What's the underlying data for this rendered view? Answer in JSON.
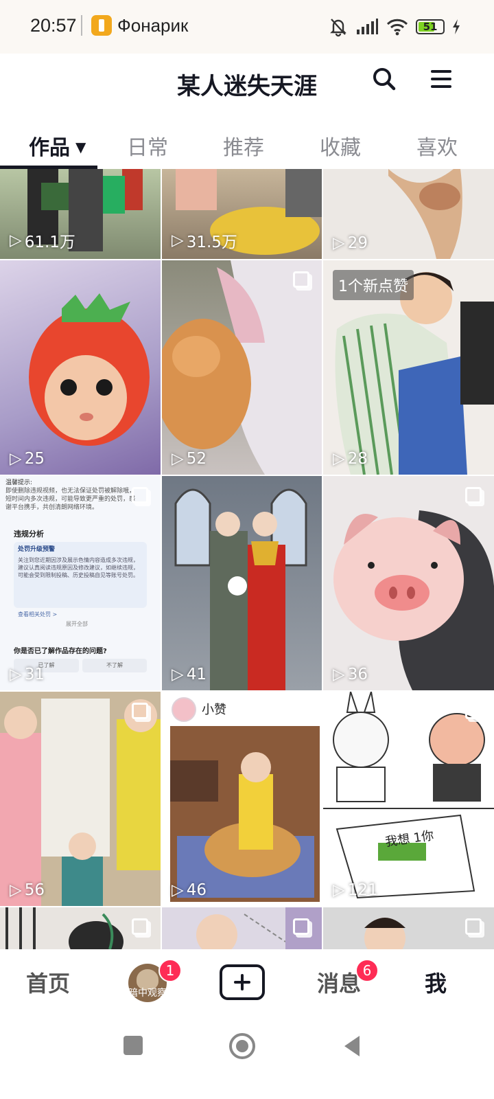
{
  "status_bar": {
    "time": "20:57",
    "app_name": "Фонарик",
    "battery": "51"
  },
  "header": {
    "title": "某人迷失天涯"
  },
  "tabs": [
    {
      "label": "作品",
      "active": true
    },
    {
      "label": "日常"
    },
    {
      "label": "推荐"
    },
    {
      "label": "收藏"
    },
    {
      "label": "喜欢"
    }
  ],
  "grid": {
    "items": [
      {
        "plays": "61.1万"
      },
      {
        "plays": "31.5万"
      },
      {
        "plays": "29"
      },
      {
        "plays": "25"
      },
      {
        "plays": "52"
      },
      {
        "plays": "28",
        "badge": "1个新点赞"
      },
      {
        "plays": "31"
      },
      {
        "plays": "41"
      },
      {
        "plays": "36"
      },
      {
        "plays": "56"
      },
      {
        "plays": "46",
        "caption": "小赞"
      },
      {
        "plays": "121"
      }
    ],
    "screenshot_text": {
      "tip_title": "温馨提示:",
      "tip_body": "即使删除违规视频，也无法保证处罚被解除哦，短时间内多次违规，可能导致更严重的处罚，感谢平台携手，共创清朗网络环境。",
      "analysis_title": "违规分析",
      "warn_title": "处罚升级预警",
      "warn_body": "关注到您近期因涉及展示色情内容造成多次违规，建议认真阅读违规原因及修改建议，如继续违规，可能会受到限制投稿、历史投稿自见等账号处罚。",
      "view_link": "查看相关处罚 >",
      "expand": "展开全部",
      "question": "你是否已了解作品存在的问题?",
      "btn_yes": "已了解",
      "btn_no": "不了解"
    },
    "comic_text": "我想 1你"
  },
  "bottom_nav": {
    "home": "首页",
    "friend_avatar_text": "暗中观察",
    "friend_badge": "1",
    "messages": "消息",
    "messages_badge": "6",
    "me": "我"
  }
}
